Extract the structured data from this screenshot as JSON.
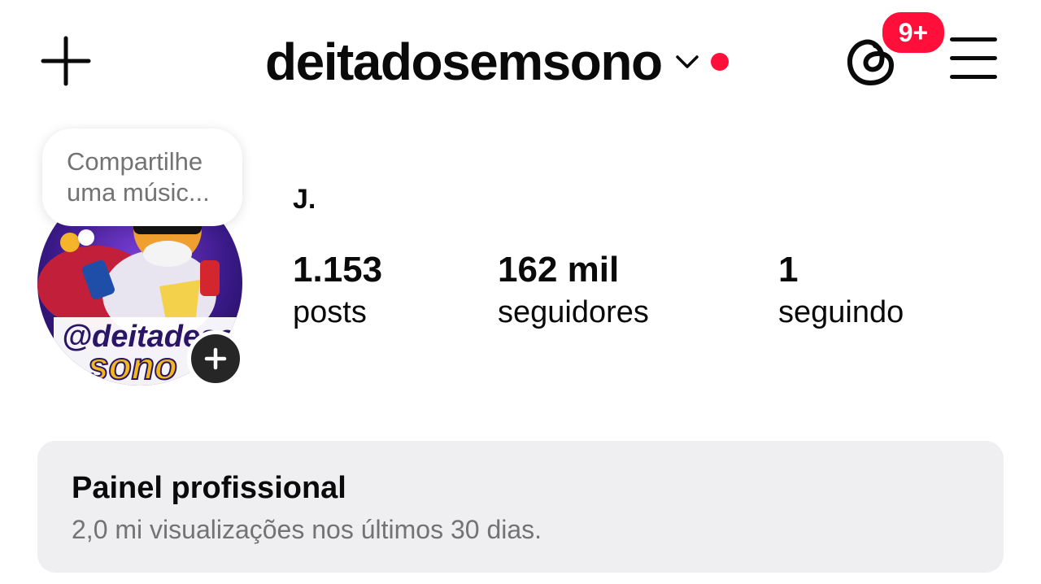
{
  "header": {
    "username": "deitadosemsono",
    "threads_badge": "9+",
    "accent_color": "#ff0f3a"
  },
  "note": {
    "line1": "Compartilhe",
    "line2": "uma músic..."
  },
  "avatar": {
    "handle_line1": "@deitadesem",
    "handle_line2": "sono"
  },
  "profile": {
    "display_name": "J.",
    "stats": [
      {
        "value": "1.153",
        "label": "posts"
      },
      {
        "value": "162 mil",
        "label": "seguidores"
      },
      {
        "value": "1",
        "label": "seguindo"
      }
    ]
  },
  "dashboard": {
    "title": "Painel profissional",
    "subtitle": "2,0 mi visualizações nos últimos 30 dias."
  }
}
